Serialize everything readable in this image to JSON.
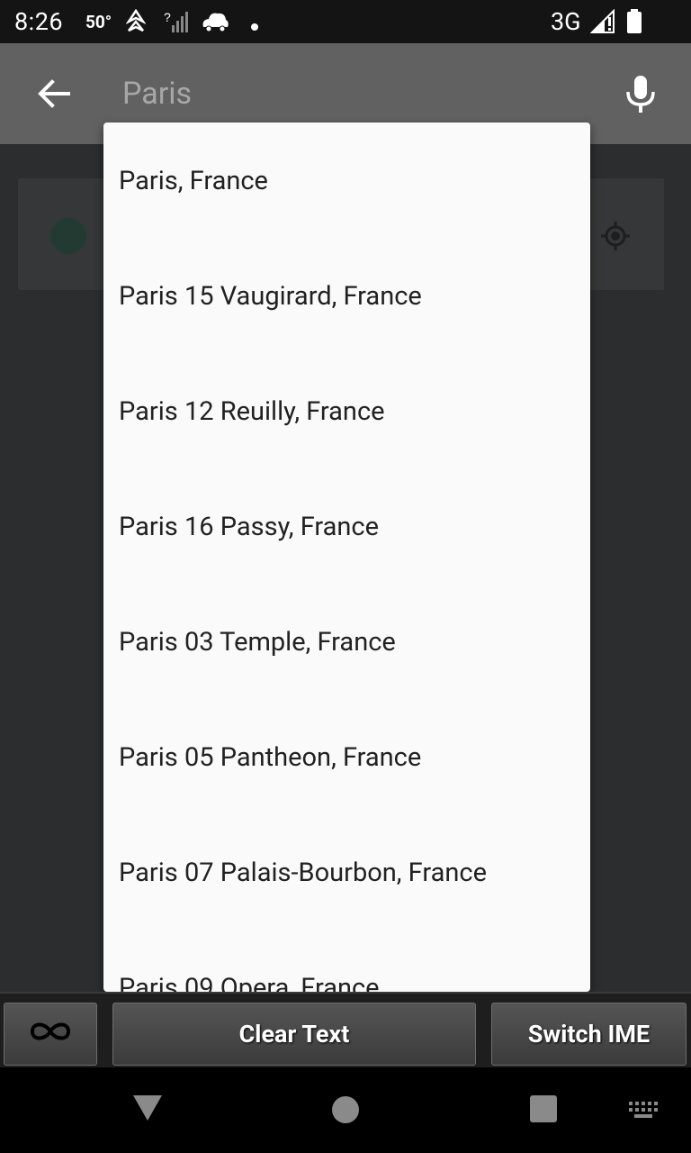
{
  "status_bar": {
    "time": "8:26",
    "temperature": "50°",
    "network": "3G",
    "icons": [
      "navigation-arrow-icon",
      "no-signal-icon",
      "cloud-car-icon",
      "notification-dot-icon",
      "signal-alert-icon",
      "battery-icon"
    ]
  },
  "search": {
    "value": "Paris",
    "placeholder": ""
  },
  "suggestions": [
    "Paris, France",
    "Paris 15 Vaugirard, France",
    "Paris 12 Reuilly, France",
    "Paris 16 Passy, France",
    "Paris 03 Temple, France",
    "Paris 05 Pantheon, France",
    "Paris 07 Palais-Bourbon, France",
    "Paris 09 Opera, France"
  ],
  "toolbar": {
    "clear_label": "Clear Text",
    "switch_label": "Switch IME"
  },
  "colors": {
    "app_bar": "#616161",
    "dropdown_bg": "#fafafa",
    "text_primary": "#212121",
    "hint": "#a7a7a7"
  }
}
